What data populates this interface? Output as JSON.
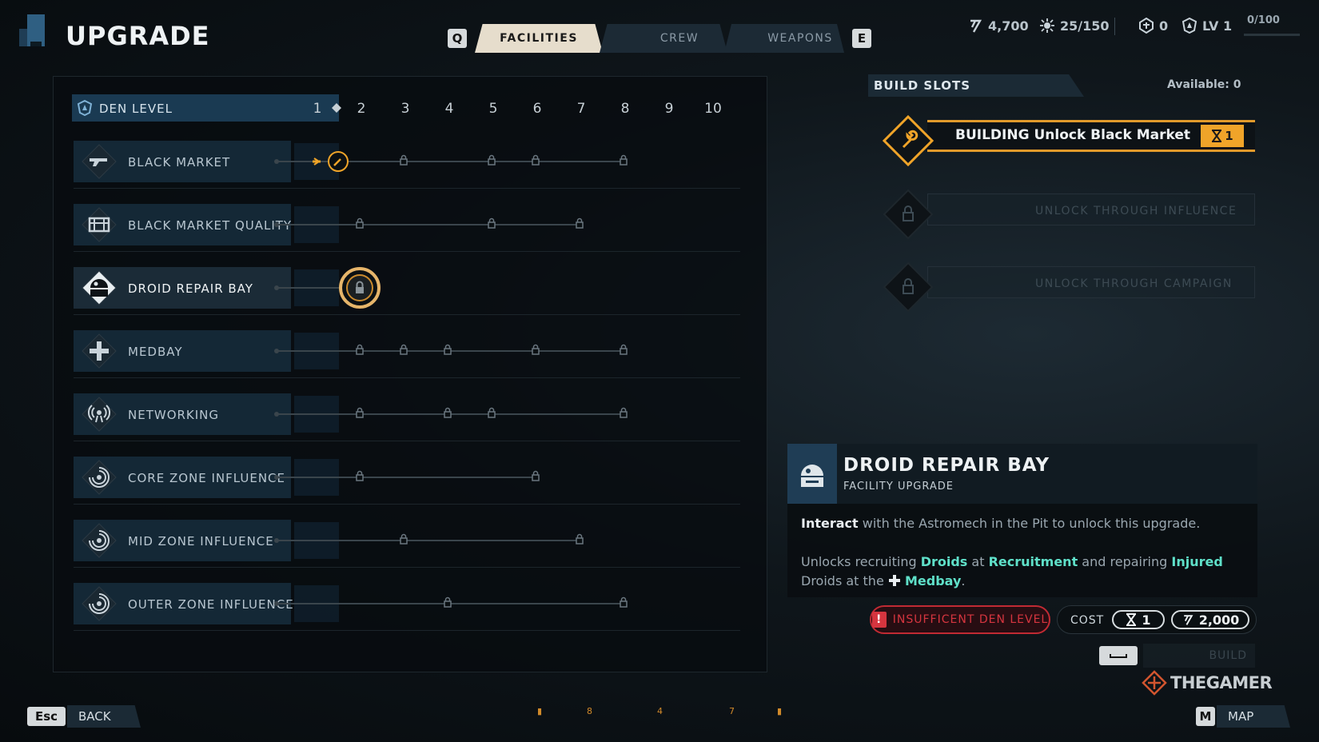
{
  "header": {
    "title": "UPGRADE",
    "tab_prev_key": "Q",
    "tab_next_key": "E",
    "tabs": [
      {
        "label": "FACILITIES",
        "active": true
      },
      {
        "label": "CREW",
        "active": false
      },
      {
        "label": "WEAPONS",
        "active": false
      }
    ],
    "stats": {
      "credits": "4,700",
      "influence": "25/150",
      "tokens": "0",
      "level": "LV 1",
      "xp": "0/100"
    }
  },
  "den": {
    "label": "DEN LEVEL",
    "levels": [
      "1",
      "2",
      "3",
      "4",
      "5",
      "6",
      "7",
      "8",
      "9",
      "10"
    ],
    "current_level": 1
  },
  "facilities": [
    {
      "label": "BLACK MARKET",
      "icon": "blaster-icon",
      "locks": [
        3,
        5,
        6,
        8
      ],
      "state": "building"
    },
    {
      "label": "BLACK MARKET QUALITY",
      "icon": "chest-icon",
      "locks": [
        2,
        5,
        7
      ],
      "state": "locked"
    },
    {
      "label": "DROID REPAIR BAY",
      "icon": "droid-icon",
      "locks": [
        2
      ],
      "state": "selected"
    },
    {
      "label": "MEDBAY",
      "icon": "medical-cross-icon",
      "locks": [
        2,
        3,
        4,
        6,
        8
      ],
      "state": "locked"
    },
    {
      "label": "NETWORKING",
      "icon": "broadcast-icon",
      "locks": [
        2,
        4,
        5,
        8
      ],
      "state": "locked"
    },
    {
      "label": "CORE ZONE INFLUENCE",
      "icon": "zone-icon",
      "locks": [
        2,
        6
      ],
      "state": "locked"
    },
    {
      "label": "MID ZONE INFLUENCE",
      "icon": "zone-icon",
      "locks": [
        3,
        7
      ],
      "state": "locked"
    },
    {
      "label": "OUTER ZONE INFLUENCE",
      "icon": "zone-icon",
      "locks": [
        4,
        8
      ],
      "state": "locked"
    }
  ],
  "build_slots": {
    "title": "BUILD SLOTS",
    "available": "Available: 0",
    "slots": [
      {
        "text": "BUILDING Unlock Black Market",
        "badge": "1",
        "state": "building"
      },
      {
        "text": "UNLOCK THROUGH INFLUENCE",
        "state": "locked"
      },
      {
        "text": "UNLOCK THROUGH CAMPAIGN",
        "state": "locked"
      }
    ]
  },
  "detail": {
    "title": "DROID REPAIR BAY",
    "subtitle": "FACILITY UPGRADE",
    "line1_a": "Interact",
    "line1_b": " with the Astromech in the Pit to unlock this upgrade.",
    "line2_a": "Unlocks recruiting ",
    "line2_b": "Droids",
    "line2_c": " at ",
    "line2_d": "Recruitment",
    "line2_e": " and repairing ",
    "line2_f": "Injured",
    "line2_g": " Droids at the ",
    "line2_h": "Medbay",
    "line2_i": "."
  },
  "requirement": {
    "warning": "INSUFFICENT DEN LEVEL",
    "cost_label": "COST",
    "cost_time": "1",
    "cost_credits": "2,000"
  },
  "actions": {
    "build_label": "BUILD",
    "back_key": "Esc",
    "back_label": "BACK",
    "map_key": "M",
    "map_label": "MAP"
  },
  "pager": [
    "8",
    "4",
    "7"
  ],
  "watermark": "THEGAMER",
  "colors": {
    "accent_orange": "#f0a429",
    "panel_blue": "#1a3a52",
    "highlight_teal": "#5fe0c9",
    "warning_red": "#d6353f"
  }
}
